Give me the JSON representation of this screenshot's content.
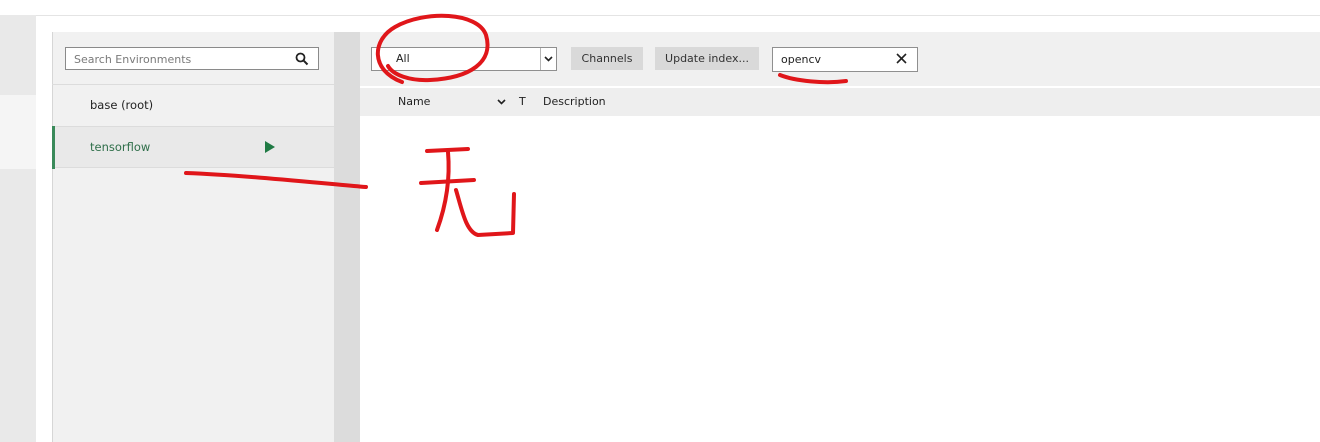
{
  "environments": {
    "search": {
      "placeholder": "Search Environments"
    },
    "items": [
      {
        "label": "base (root)",
        "active": false
      },
      {
        "label": "tensorflow",
        "active": true
      }
    ]
  },
  "packages": {
    "filter": {
      "selected": "All"
    },
    "buttons": {
      "channels": "Channels",
      "update_index": "Update index..."
    },
    "search": {
      "value": "opencv"
    },
    "table": {
      "columns": [
        "Name",
        "T",
        "Description"
      ]
    }
  },
  "annotations": {
    "handwritten_char": "无",
    "color": "#e0161a"
  },
  "colors": {
    "accent_green": "#2f6f4a",
    "play_green": "#1f7a44"
  }
}
